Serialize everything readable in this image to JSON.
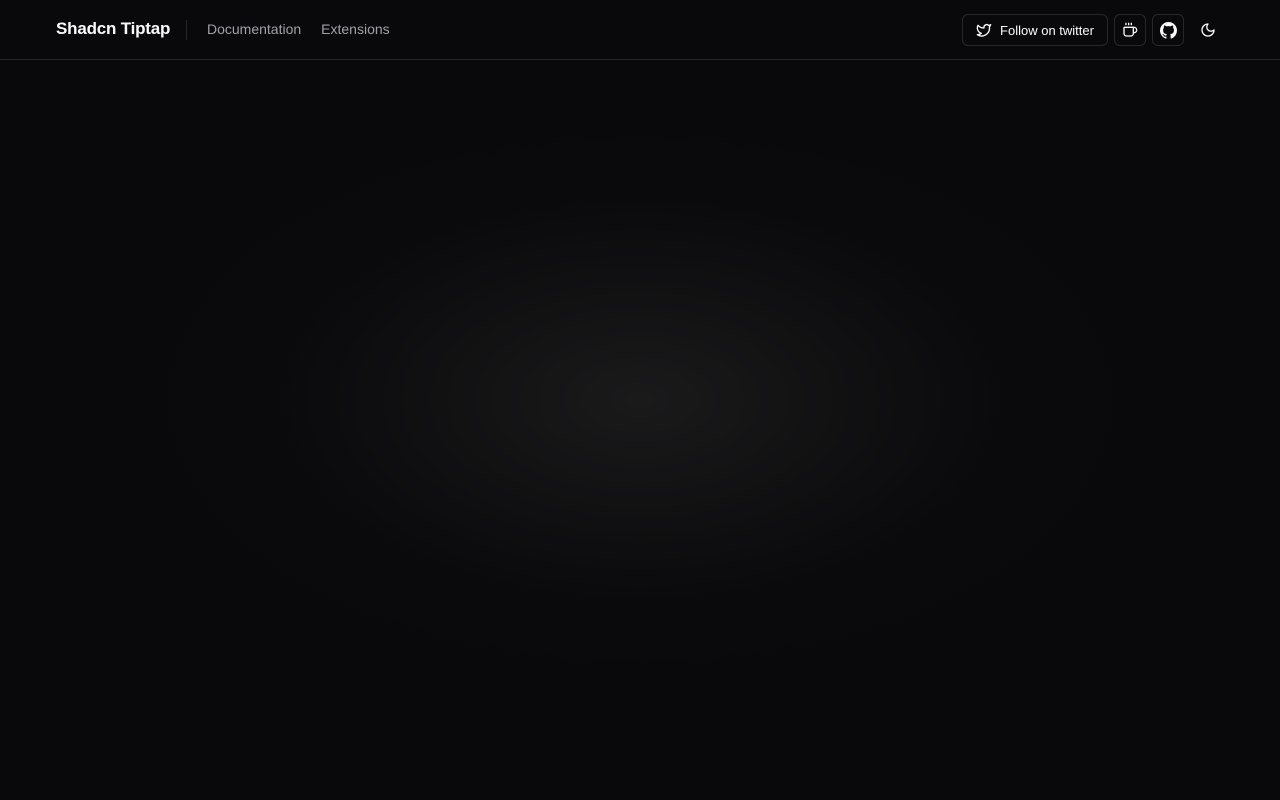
{
  "header": {
    "brand": "Shadcn Tiptap",
    "nav": [
      {
        "label": "Documentation"
      },
      {
        "label": "Extensions"
      }
    ],
    "actions": {
      "twitter_label": "Follow on twitter",
      "twitter_icon": "twitter-icon",
      "coffee_icon": "coffee-icon",
      "github_icon": "github-icon",
      "theme_icon": "moon-icon"
    }
  },
  "colors": {
    "background": "#09090b",
    "border": "#27272a",
    "text": "#fafafa",
    "muted_text": "#a1a1aa"
  }
}
